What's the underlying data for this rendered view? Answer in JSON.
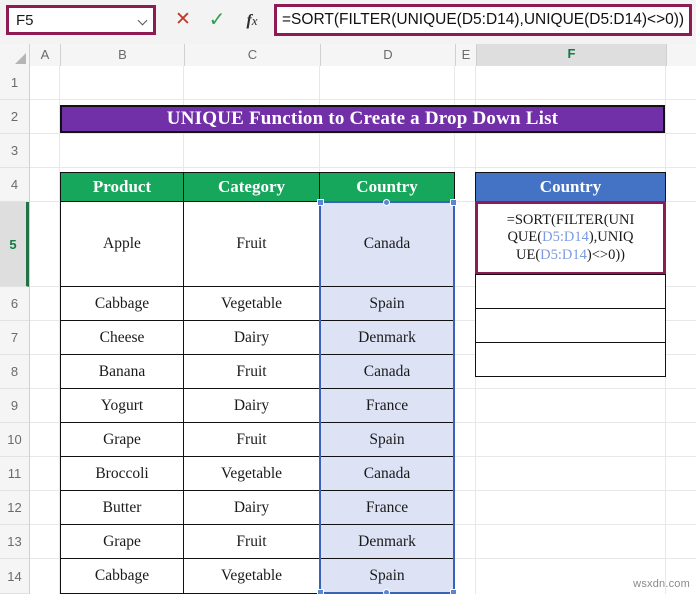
{
  "formula_bar": {
    "name_box_value": "F5",
    "cancel_icon_glyph": "✕",
    "enter_icon_glyph": "✓",
    "fx_label": "fx",
    "formula_text": "=SORT(FILTER(UNIQUE(D5:D14),UNIQUE(D5:D14)<>0))"
  },
  "grid": {
    "columns": [
      "A",
      "B",
      "C",
      "D",
      "E",
      "F"
    ],
    "active_column": "F",
    "rows": [
      "1",
      "2",
      "3",
      "4",
      "5",
      "6",
      "7",
      "8",
      "9",
      "10",
      "11",
      "12",
      "13",
      "14"
    ],
    "active_row": "5"
  },
  "title_banner": {
    "text": "UNIQUE Function to Create a Drop Down List",
    "fill_color": "#7230A8",
    "text_color": "#FFFFFF"
  },
  "table": {
    "headers": [
      "Product",
      "Category",
      "Country"
    ],
    "header_fill": "#16A75C",
    "rows": [
      {
        "product": "Apple",
        "category": "Fruit",
        "country": "Canada"
      },
      {
        "product": "Cabbage",
        "category": "Vegetable",
        "country": "Spain"
      },
      {
        "product": "Cheese",
        "category": "Dairy",
        "country": "Denmark"
      },
      {
        "product": "Banana",
        "category": "Fruit",
        "country": "Canada"
      },
      {
        "product": "Yogurt",
        "category": "Dairy",
        "country": "France"
      },
      {
        "product": "Grape",
        "category": "Fruit",
        "country": "Spain"
      },
      {
        "product": "Broccoli",
        "category": "Vegetable",
        "country": "Canada"
      },
      {
        "product": "Butter",
        "category": "Dairy",
        "country": "France"
      },
      {
        "product": "Grape",
        "category": "Fruit",
        "country": "Denmark"
      },
      {
        "product": "Cabbage",
        "category": "Vegetable",
        "country": "Spain"
      }
    ]
  },
  "output_table": {
    "header": "Country",
    "header_fill": "#4472C4",
    "active_cell": "F5",
    "cell_formula_line1": "=SORT(FILTER(UNI",
    "cell_formula_line2_a": "QUE(",
    "cell_formula_line2_ref": "D5:D14",
    "cell_formula_line2_b": "),UNIQ",
    "cell_formula_line3_a": "UE(",
    "cell_formula_line3_ref": "D5:D14",
    "cell_formula_line3_b": ")<>0))",
    "empty_cells": [
      "",
      "",
      ""
    ]
  },
  "selection": {
    "range": "D5:D14",
    "border_color": "#3A62B8",
    "fill_color": "#DDE3F5"
  },
  "watermark": {
    "text": "wsxdn.com"
  }
}
